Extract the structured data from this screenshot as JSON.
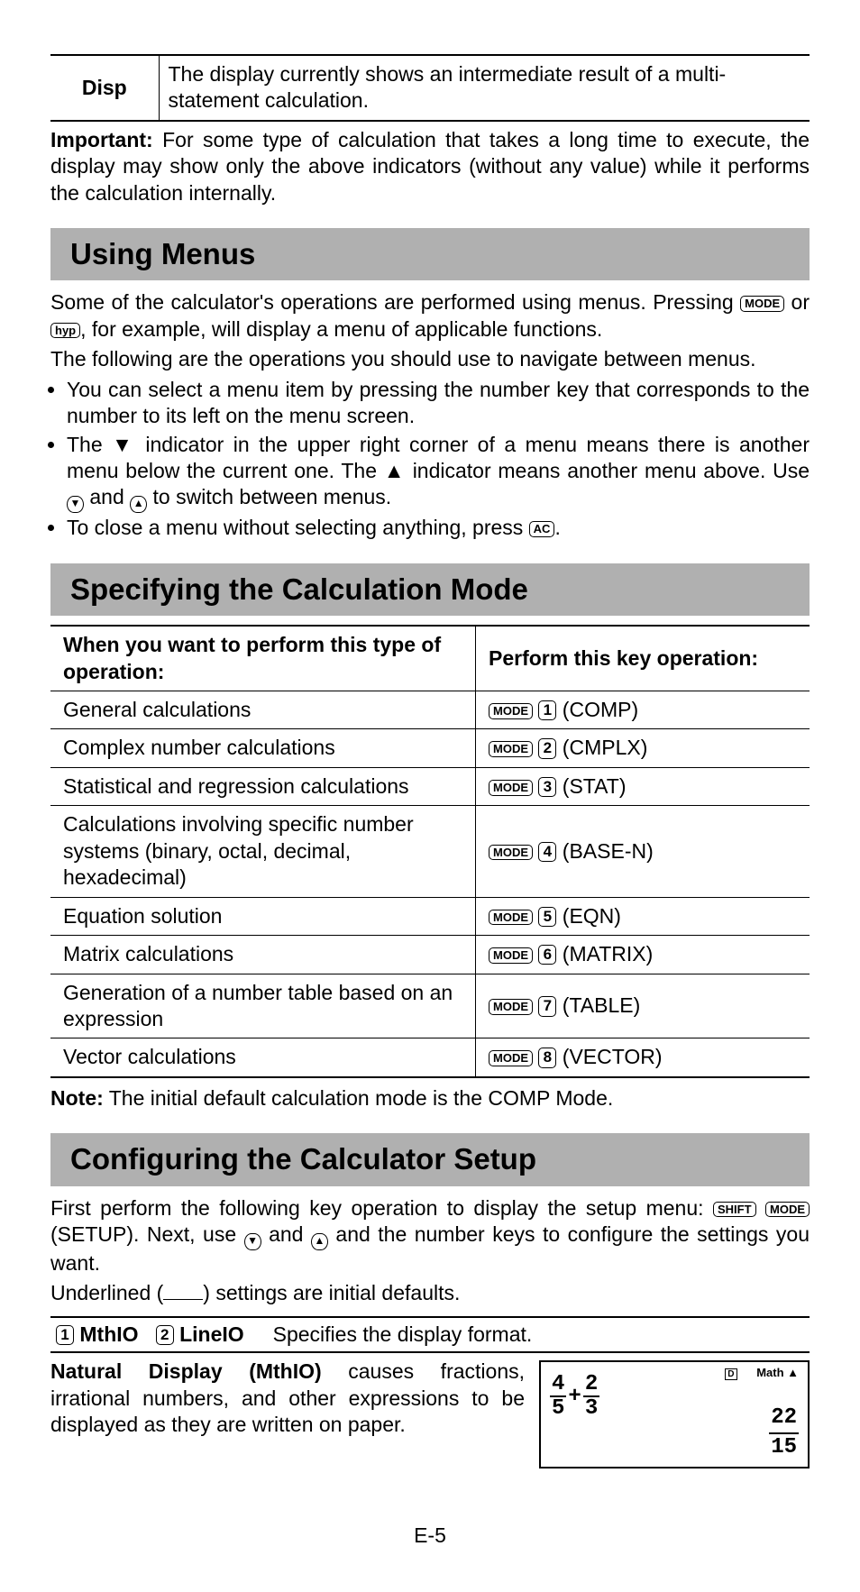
{
  "disp_table": {
    "label": "Disp",
    "desc": "The display currently shows an intermediate result of a multi-statement calculation."
  },
  "important_label": "Important:",
  "important_text": " For some type of calculation that takes a long time to execute, the display may show only the above indicators (without any value) while it performs the calculation internally.",
  "using_menus": {
    "header": "Using Menus",
    "intro1a": "Some of the calculator's operations are performed using menus. Pressing ",
    "intro1b": " or ",
    "intro1c": ", for example, will display a menu of applicable functions.",
    "intro2": "The following are the operations you should use to navigate between menus.",
    "bullet1": "You can select a menu item by pressing the number key that corresponds to the number to its left on the menu screen.",
    "bullet2a": "The ▼ indicator in the upper right corner of a menu means there is another menu below the current one. The ▲ indicator means another menu above. Use ",
    "bullet2b": " and ",
    "bullet2c": " to switch between menus.",
    "bullet3a": "To close a menu without selecting anything, press ",
    "bullet3b": "."
  },
  "keys": {
    "mode": "MODE",
    "hyp": "hyp",
    "ac": "AC",
    "shift": "SHIFT"
  },
  "mode_section": {
    "header": "Specifying the Calculation Mode",
    "th1": "When you want to perform this type of operation:",
    "th2": "Perform this key operation:",
    "rows": [
      {
        "op": "General calculations",
        "num": "1",
        "name": "(COMP)"
      },
      {
        "op": "Complex number calculations",
        "num": "2",
        "name": "(CMPLX)"
      },
      {
        "op": "Statistical and regression calculations",
        "num": "3",
        "name": "(STAT)"
      },
      {
        "op": "Calculations involving specific number systems (binary, octal, decimal, hexadecimal)",
        "num": "4",
        "name": "(BASE-N)"
      },
      {
        "op": "Equation solution",
        "num": "5",
        "name": "(EQN)"
      },
      {
        "op": "Matrix calculations",
        "num": "6",
        "name": "(MATRIX)"
      },
      {
        "op": "Generation of a number table based on an expression",
        "num": "7",
        "name": "(TABLE)"
      },
      {
        "op": "Vector calculations",
        "num": "8",
        "name": "(VECTOR)"
      }
    ],
    "note_label": "Note:",
    "note_text": " The initial default calculation mode is the COMP Mode."
  },
  "setup_section": {
    "header": "Configuring the Calculator Setup",
    "intro_a": "First perform the following key operation to display the setup menu: ",
    "intro_b": "(SETUP). Next, use ",
    "intro_c": " and ",
    "intro_d": " and the number keys to configure the settings you want.",
    "underline_text_a": "Underlined (",
    "underline_text_b": ") settings are initial defaults.",
    "row": {
      "k1": "1",
      "l1": "MthIO",
      "k2": "2",
      "l2": "LineIO",
      "desc": "Specifies the display format."
    },
    "natural_label": "Natural Display (MthIO)",
    "natural_text": " causes fractions, irrational numbers, and other expressions to be displayed as they are written on paper.",
    "screen": {
      "indic_d": "D",
      "indic_math": "Math ▲",
      "f1n": "4",
      "f1d": "5",
      "f2n": "2",
      "f2d": "3",
      "rn": "22",
      "rd": "15"
    }
  },
  "page_num": "E-5"
}
